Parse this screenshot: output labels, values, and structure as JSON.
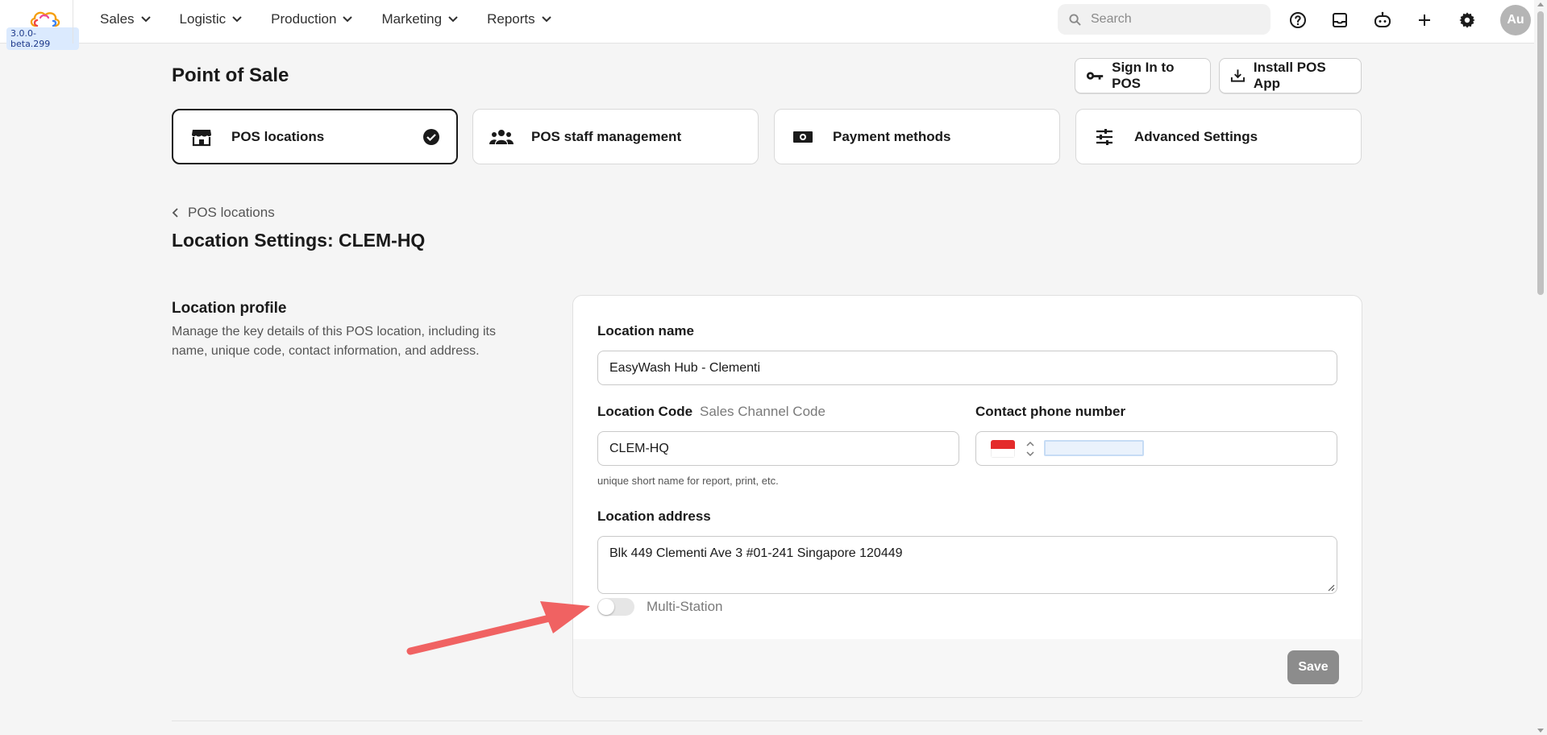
{
  "app": {
    "version": "3.0.0-beta.299",
    "avatar_initials": "Au",
    "accent": "#1a1a1a"
  },
  "nav": {
    "items": [
      {
        "label": "Sales"
      },
      {
        "label": "Logistic"
      },
      {
        "label": "Production"
      },
      {
        "label": "Marketing"
      },
      {
        "label": "Reports"
      }
    ],
    "search_placeholder": "Search"
  },
  "header": {
    "title": "Point of Sale",
    "sign_in_label": "Sign In to POS",
    "install_label": "Install POS App"
  },
  "tabs": [
    {
      "label": "POS locations",
      "icon": "store-icon",
      "active": true
    },
    {
      "label": "POS staff management",
      "icon": "users-icon",
      "active": false
    },
    {
      "label": "Payment methods",
      "icon": "cash-icon",
      "active": false
    },
    {
      "label": "Advanced Settings",
      "icon": "sliders-icon",
      "active": false
    }
  ],
  "breadcrumb": {
    "label": "POS locations"
  },
  "page": {
    "heading": "Location Settings: CLEM-HQ"
  },
  "section": {
    "title": "Location profile",
    "description": "Manage the key details of this POS location, including its name, unique code, contact information, and address."
  },
  "form": {
    "location_name_label": "Location name",
    "location_name_value": "EasyWash Hub - Clementi",
    "location_code_label": "Location Code",
    "sales_channel_label": "Sales Channel Code",
    "location_code_value": "CLEM-HQ",
    "location_code_hint": "unique short name for report, print, etc.",
    "phone_label": "Contact phone number",
    "phone_value": "",
    "address_label": "Location address",
    "address_value": "Blk 449 Clementi Ave 3 #01-241 Singapore 120449",
    "multi_station_label": "Multi-Station",
    "multi_station_enabled": false,
    "save_label": "Save"
  },
  "colors": {
    "annotation_arrow": "#f06262",
    "save_disabled": "#8c8c8c"
  }
}
